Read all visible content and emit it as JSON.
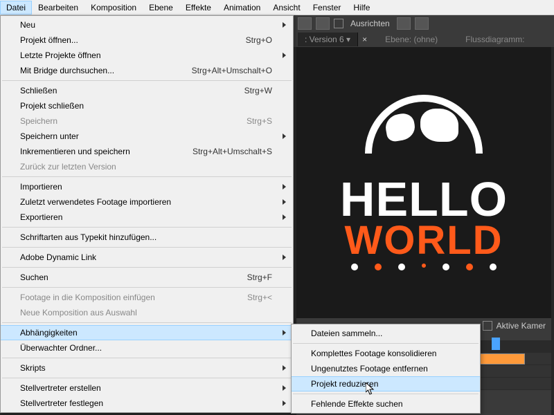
{
  "menubar": {
    "items": [
      "Datei",
      "Bearbeiten",
      "Komposition",
      "Ebene",
      "Effekte",
      "Animation",
      "Ansicht",
      "Fenster",
      "Hilfe"
    ]
  },
  "toolbar": {
    "align_label": "Ausrichten"
  },
  "panel": {
    "comp_tab": ": Version 6",
    "layer_label": "Ebene: (ohne)",
    "flowchart_label": "Flussdiagramm:"
  },
  "viewer_footer": {
    "camera_label": "Aktive Kamer"
  },
  "comp": {
    "hello": "HELLO",
    "world": "WORLD"
  },
  "file_menu": [
    {
      "label": "Neu",
      "shortcut": "",
      "submenu": true
    },
    {
      "label": "Projekt öffnen...",
      "shortcut": "Strg+O"
    },
    {
      "label": "Letzte Projekte öffnen",
      "shortcut": "",
      "submenu": true
    },
    {
      "label": "Mit Bridge durchsuchen...",
      "shortcut": "Strg+Alt+Umschalt+O"
    },
    {
      "sep": true
    },
    {
      "label": "Schließen",
      "shortcut": "Strg+W"
    },
    {
      "label": "Projekt schließen",
      "shortcut": ""
    },
    {
      "label": "Speichern",
      "shortcut": "Strg+S",
      "disabled": true
    },
    {
      "label": "Speichern unter",
      "shortcut": "",
      "submenu": true
    },
    {
      "label": "Inkrementieren und speichern",
      "shortcut": "Strg+Alt+Umschalt+S"
    },
    {
      "label": "Zurück zur letzten Version",
      "shortcut": "",
      "disabled": true
    },
    {
      "sep": true
    },
    {
      "label": "Importieren",
      "shortcut": "",
      "submenu": true
    },
    {
      "label": "Zuletzt verwendetes Footage importieren",
      "shortcut": "",
      "submenu": true
    },
    {
      "label": "Exportieren",
      "shortcut": "",
      "submenu": true
    },
    {
      "sep": true
    },
    {
      "label": "Schriftarten aus Typekit hinzufügen...",
      "shortcut": ""
    },
    {
      "sep": true
    },
    {
      "label": "Adobe Dynamic Link",
      "shortcut": "",
      "submenu": true
    },
    {
      "sep": true
    },
    {
      "label": "Suchen",
      "shortcut": "Strg+F"
    },
    {
      "sep": true
    },
    {
      "label": "Footage in die Komposition einfügen",
      "shortcut": "Strg+<",
      "disabled": true
    },
    {
      "label": "Neue Komposition aus Auswahl",
      "shortcut": "",
      "disabled": true
    },
    {
      "sep": true
    },
    {
      "label": "Abhängigkeiten",
      "shortcut": "",
      "submenu": true,
      "hover": true
    },
    {
      "label": "Überwachter Ordner...",
      "shortcut": ""
    },
    {
      "sep": true
    },
    {
      "label": "Skripts",
      "shortcut": "",
      "submenu": true
    },
    {
      "sep": true
    },
    {
      "label": "Stellvertreter erstellen",
      "shortcut": "",
      "submenu": true
    },
    {
      "label": "Stellvertreter festlegen",
      "shortcut": "",
      "submenu": true
    }
  ],
  "dep_submenu": [
    {
      "label": "Dateien sammeln..."
    },
    {
      "sep": true
    },
    {
      "label": "Komplettes Footage konsolidieren"
    },
    {
      "label": "Ungenutztes Footage entfernen"
    },
    {
      "label": "Projekt reduzieren",
      "hover": true
    },
    {
      "sep": true
    },
    {
      "label": "Fehlende Effekte suchen"
    }
  ]
}
